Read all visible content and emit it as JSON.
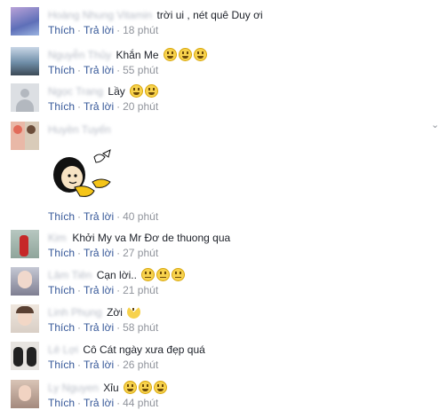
{
  "actions": {
    "like": "Thích",
    "reply": "Trả lời",
    "separator": "·"
  },
  "comments": [
    {
      "name": "Hoàng Nhung Vitamin",
      "text": "trời ui , nét quê Duy ơi",
      "emojis": [],
      "time": "18 phút"
    },
    {
      "name": "Nguyễn Thủy",
      "text": "Khắn Me",
      "emojis": [
        "laugh",
        "laugh",
        "laugh"
      ],
      "time": "55 phút"
    },
    {
      "name": "Ngọc Trang",
      "text": "Lầy",
      "emojis": [
        "laugh",
        "laugh"
      ],
      "time": "20 phút"
    },
    {
      "name": "Huyền Tuyến",
      "text": "",
      "emojis": [],
      "time": "40 phút",
      "sticker": true
    },
    {
      "name": "Kim",
      "text": "Khởi My va Mr Đơ de thuong qua",
      "emojis": [],
      "time": "27 phút"
    },
    {
      "name": "Lâm Tiên",
      "text": "Cạn lời..",
      "emojis": [
        "flat",
        "flat",
        "flat"
      ],
      "time": "21 phút"
    },
    {
      "name": "Linh Phụng",
      "text": "Zời",
      "emojis": [
        "pac"
      ],
      "time": "58 phút"
    },
    {
      "name": "Lê Lợi",
      "text": "Cô Cát ngày xưa đẹp quá",
      "emojis": [],
      "time": "26 phút"
    },
    {
      "name": "Ly Nguyen",
      "text": "Xỉu",
      "emojis": [
        "laugh",
        "laugh",
        "laugh"
      ],
      "time": "44 phút"
    }
  ],
  "icons": {
    "menu": "chevron-down-icon",
    "emoji_laugh": "grinning-face-icon",
    "emoji_flat": "neutral-face-icon"
  },
  "colors": {
    "link": "#365899",
    "meta": "#90949c",
    "text": "#1d2129"
  }
}
